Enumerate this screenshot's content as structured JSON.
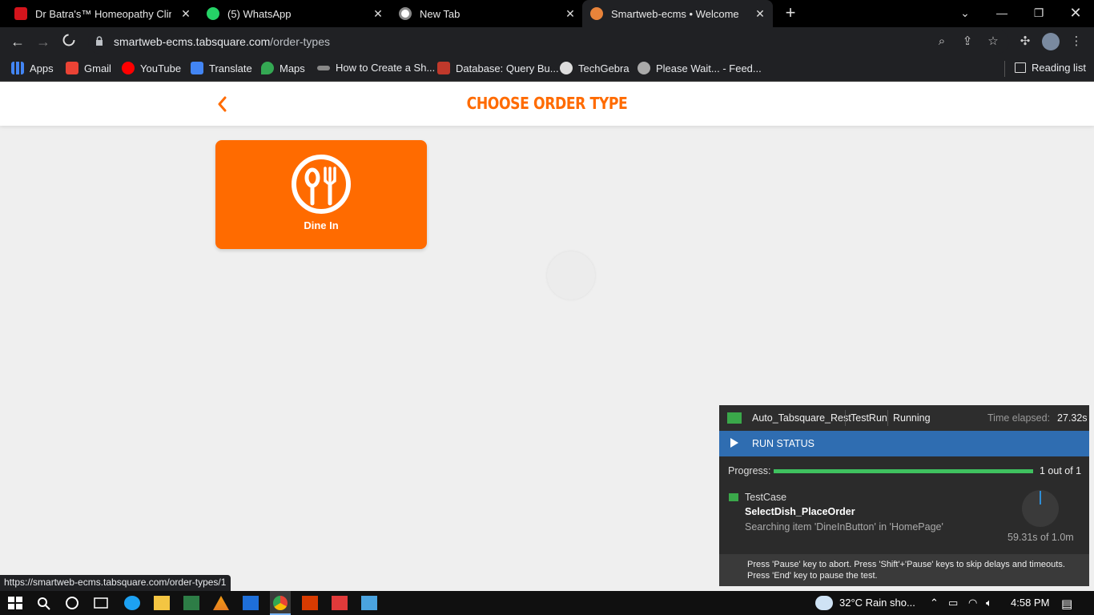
{
  "browser": {
    "tabs": [
      {
        "title": "Dr Batra's™ Homeopathy Clinics",
        "favicon": "dr-batras-icon"
      },
      {
        "title": "(5) WhatsApp",
        "favicon": "whatsapp-icon"
      },
      {
        "title": "New Tab",
        "favicon": "chrome-icon"
      },
      {
        "title": "Smartweb-ecms • Welcome",
        "favicon": "tabsquare-icon",
        "active": true
      }
    ],
    "url_host": "smartweb-ecms.tabsquare.com",
    "url_path": "/order-types",
    "bookmarks": [
      "Apps",
      "Gmail",
      "YouTube",
      "Translate",
      "Maps",
      "How to Create a Sh...",
      "Database: Query Bu...",
      "TechGebra",
      "Please Wait... - Feed..."
    ],
    "reading_list": "Reading list",
    "status_url": "https://smartweb-ecms.tabsquare.com/order-types/1"
  },
  "page": {
    "title": "CHOOSE ORDER TYPE",
    "accent_color": "#ff6b00",
    "order_types": [
      {
        "label": "Dine In",
        "icon": "spoon-fork-icon"
      }
    ]
  },
  "run_panel": {
    "project": "Auto_Tabsquare_Rest",
    "run_name": "TestRun",
    "state": "Running",
    "elapsed_label": "Time elapsed:",
    "elapsed_value": "27.32s",
    "section_title": "RUN STATUS",
    "progress_label": "Progress:",
    "progress_fraction": 1.0,
    "progress_count": "1 out of 1",
    "testcase_type": "TestCase",
    "testcase_name": "SelectDish_PlaceOrder",
    "testcase_status": "Searching item 'DineInButton' in 'HomePage'",
    "time_progress": "59.31s of 1.0m",
    "hint_line1": "Press 'Pause' key to abort. Press 'Shift'+'Pause' keys to skip delays and timeouts.",
    "hint_line2": "Press 'End' key to pause the test."
  },
  "taskbar": {
    "weather": "32°C  Rain sho...",
    "time": "4:58 PM"
  }
}
